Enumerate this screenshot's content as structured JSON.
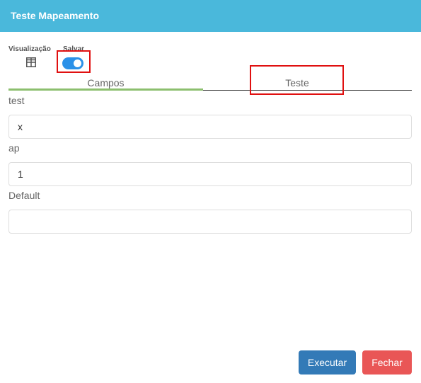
{
  "header": {
    "title": "Teste Mapeamento"
  },
  "toolbar": {
    "visualizacao_label": "Visualização",
    "visualizacao_icon": "table-grid-icon",
    "salvar_label": "Salvar",
    "salvar_on": true
  },
  "tabs": [
    {
      "label": "Campos",
      "active": true
    },
    {
      "label": "Teste",
      "active": false
    }
  ],
  "fields": [
    {
      "label": "test",
      "value": "x"
    },
    {
      "label": "ap",
      "value": "1"
    },
    {
      "label": "Default",
      "value": ""
    }
  ],
  "buttons": {
    "execute": "Executar",
    "close": "Fechar"
  },
  "colors": {
    "header": "#4ab8db",
    "toggle": "#2b91e8",
    "active_tab": "#8cbf6e",
    "execute": "#337ab7",
    "close": "#e95656",
    "highlight": "#e01010"
  }
}
